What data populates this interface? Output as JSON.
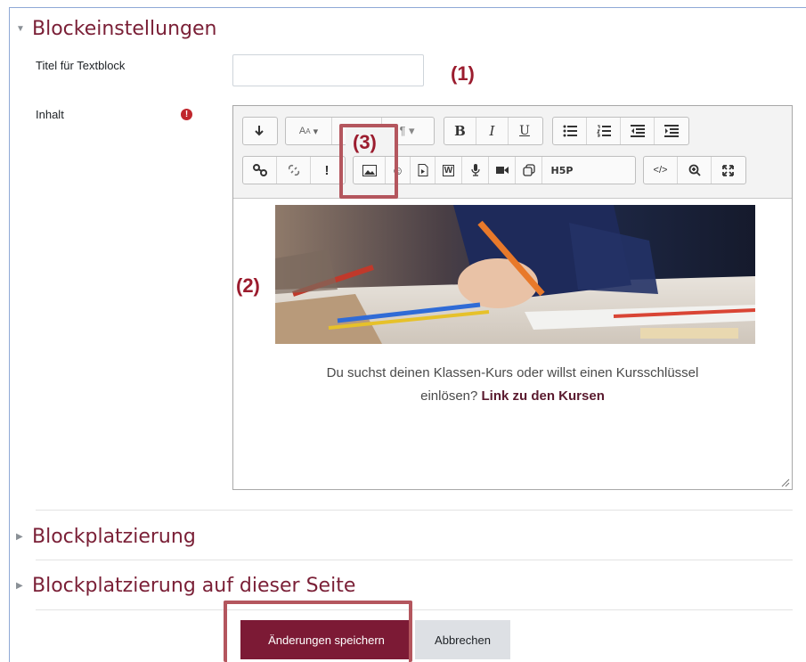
{
  "sections": {
    "blockeinstellungen": "Blockeinstellungen",
    "blockplatzierung": "Blockplatzierung",
    "blockplatzierung_seite": "Blockplatzierung auf dieser Seite"
  },
  "form": {
    "title_label": "Titel für Textblock",
    "title_value": "",
    "content_label": "Inhalt",
    "required_mark": "!"
  },
  "annotations": {
    "a1": "(1)",
    "a2": "(2)",
    "a3": "(3)"
  },
  "toolbar": {
    "row1": [
      {
        "name": "collapse-toolbar-icon",
        "glyph": "↴"
      },
      {
        "name": "font-color-icon",
        "glyph": "A▾"
      },
      {
        "name": "style-menu-icon",
        "glyph": "▾"
      },
      {
        "name": "paragraph-style-icon",
        "glyph": "¶▾"
      },
      {
        "name": "bold-icon",
        "glyph": "B"
      },
      {
        "name": "italic-icon",
        "glyph": "I"
      },
      {
        "name": "underline-icon",
        "glyph": "U"
      },
      {
        "name": "bullet-list-icon",
        "glyph": "☰"
      },
      {
        "name": "numbered-list-icon",
        "glyph": "☷"
      },
      {
        "name": "outdent-icon",
        "glyph": "⇤"
      },
      {
        "name": "indent-icon",
        "glyph": "⇥"
      }
    ],
    "row2": [
      {
        "name": "link-icon",
        "glyph": "🔗"
      },
      {
        "name": "unlink-icon",
        "glyph": "⛓"
      },
      {
        "name": "emoticon-icon",
        "glyph": "!"
      },
      {
        "name": "image-icon",
        "glyph": "▣"
      },
      {
        "name": "smiley-icon",
        "glyph": "☺"
      },
      {
        "name": "media-icon",
        "glyph": "▶"
      },
      {
        "name": "word-import-icon",
        "glyph": "W"
      },
      {
        "name": "microphone-icon",
        "glyph": "🎙"
      },
      {
        "name": "video-icon",
        "glyph": "■"
      },
      {
        "name": "copy-icon",
        "glyph": "⧉"
      },
      {
        "name": "h5p-icon",
        "glyph": "H5P"
      },
      {
        "name": "html-icon",
        "glyph": "</>"
      },
      {
        "name": "zoom-icon",
        "glyph": "⊕"
      },
      {
        "name": "fullscreen-icon",
        "glyph": "⤢"
      }
    ]
  },
  "content": {
    "text_line1": "Du suchst deinen Klassen-Kurs oder willst einen Kursschlüssel",
    "text_line2_prefix": "einlösen?",
    "link_text": "Link zu den Kursen"
  },
  "buttons": {
    "save": "Änderungen speichern",
    "cancel": "Abbrechen"
  },
  "colors": {
    "accent": "#7c1a35",
    "annotation": "#9b1c2e",
    "highlight_box": "#b4565e"
  }
}
